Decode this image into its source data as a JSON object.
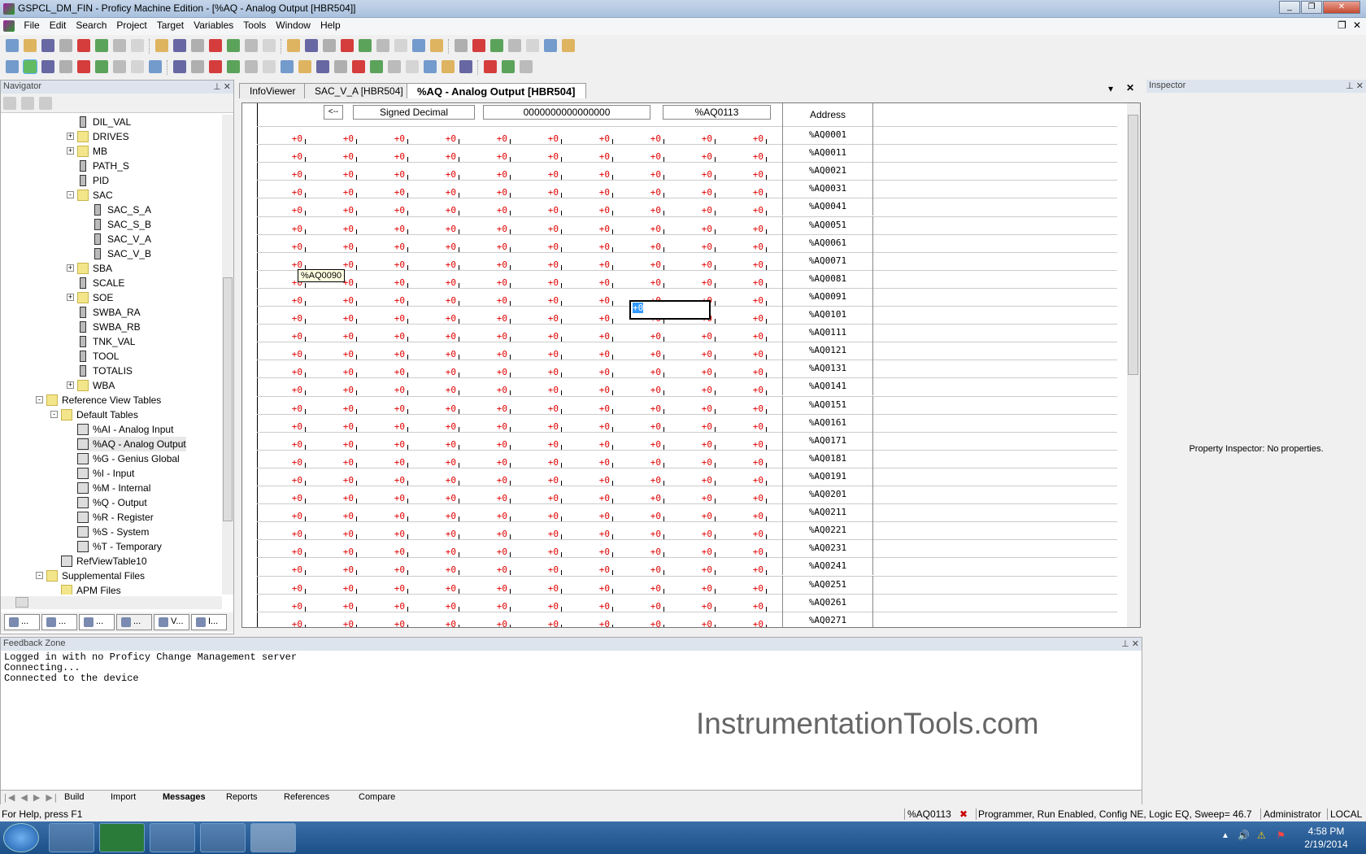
{
  "title": "GSPCL_DM_FIN - Proficy Machine Edition - [%AQ - Analog Output [HBR504]]",
  "menu": [
    "File",
    "Edit",
    "Search",
    "Project",
    "Target",
    "Variables",
    "Tools",
    "Window",
    "Help"
  ],
  "toolbar1": [
    "new-project-icon",
    "open-icon",
    "save-icon",
    "print-icon",
    "validate-check-icon",
    "download-icon",
    "upload-icon",
    "bulb-icon",
    "|",
    "cut-icon",
    "copy-icon",
    "paste-icon",
    "undo-icon",
    "redo-icon",
    "delete-icon",
    "find-icon",
    "|",
    "navigator-icon",
    "variables-icon",
    "toolchest-icon",
    "inspector-icon",
    "watch-icon",
    "companion-icon",
    "network-icon",
    "favorites-icon",
    "help-icon",
    "|",
    "back-icon",
    "forward-icon",
    "stop-icon",
    "refresh-icon",
    "home-icon",
    "infoviewer-icon",
    "export-icon"
  ],
  "toolbar2": [
    "online-icon",
    "programmer-mode-icon",
    "rewind-icon",
    "run-icon",
    "step-icon",
    "stop-icon",
    "pause-icon",
    "restart-icon",
    "alert-icon",
    "|",
    "select-icon",
    "contact-no-icon",
    "contact-nc-icon",
    "coil-icon",
    "coil-neg-icon",
    "coil-pos-icon",
    "coil-neg-trans-icon",
    "set-coil-icon",
    "reset-coil-icon",
    "timer-icon",
    "counter-icon",
    "function-block-icon",
    "function-block2-icon",
    "wire-icon",
    "branch-icon",
    "comment-icon",
    "edit-icon",
    "|",
    "binoculars-icon",
    "search-replace-icon",
    "find-all-icon"
  ],
  "navigator": {
    "title": "Navigator",
    "items": [
      {
        "label": "DIL_VAL",
        "type": "block",
        "level": 3
      },
      {
        "label": "DRIVES",
        "type": "folder",
        "level": 3,
        "exp": "+"
      },
      {
        "label": "MB",
        "type": "folder",
        "level": 3,
        "exp": "+"
      },
      {
        "label": "PATH_S",
        "type": "block",
        "level": 3
      },
      {
        "label": "PID",
        "type": "block",
        "level": 3
      },
      {
        "label": "SAC",
        "type": "folder",
        "level": 3,
        "exp": "-"
      },
      {
        "label": "SAC_S_A",
        "type": "block",
        "level": 4
      },
      {
        "label": "SAC_S_B",
        "type": "block",
        "level": 4
      },
      {
        "label": "SAC_V_A",
        "type": "block",
        "level": 4
      },
      {
        "label": "SAC_V_B",
        "type": "block",
        "level": 4
      },
      {
        "label": "SBA",
        "type": "folder",
        "level": 3,
        "exp": "+"
      },
      {
        "label": "SCALE",
        "type": "block",
        "level": 3
      },
      {
        "label": "SOE",
        "type": "folder",
        "level": 3,
        "exp": "+"
      },
      {
        "label": "SWBA_RA",
        "type": "block",
        "level": 3
      },
      {
        "label": "SWBA_RB",
        "type": "block",
        "level": 3
      },
      {
        "label": "TNK_VAL",
        "type": "block",
        "level": 3
      },
      {
        "label": "TOOL",
        "type": "block",
        "level": 3
      },
      {
        "label": "TOTALIS",
        "type": "block",
        "level": 3
      },
      {
        "label": "WBA",
        "type": "folder",
        "level": 3,
        "exp": "+"
      },
      {
        "label": "Reference View Tables",
        "type": "folder",
        "level": 1,
        "exp": "-"
      },
      {
        "label": "Default Tables",
        "type": "folder",
        "level": 2,
        "exp": "-"
      },
      {
        "label": "%AI - Analog Input",
        "type": "tbl",
        "level": 3
      },
      {
        "label": "%AQ - Analog Output",
        "type": "tbl",
        "level": 3,
        "selected": true
      },
      {
        "label": "%G - Genius Global",
        "type": "tbl",
        "level": 3
      },
      {
        "label": "%I - Input",
        "type": "tbl",
        "level": 3
      },
      {
        "label": "%M - Internal",
        "type": "tbl",
        "level": 3
      },
      {
        "label": "%Q - Output",
        "type": "tbl",
        "level": 3
      },
      {
        "label": "%R - Register",
        "type": "tbl",
        "level": 3
      },
      {
        "label": "%S - System",
        "type": "tbl",
        "level": 3
      },
      {
        "label": "%T - Temporary",
        "type": "tbl",
        "level": 3
      },
      {
        "label": "RefViewTable10",
        "type": "tbl",
        "level": 2
      },
      {
        "label": "Supplemental Files",
        "type": "folder",
        "level": 1,
        "exp": "-"
      },
      {
        "label": "APM Files",
        "type": "folder",
        "level": 2
      }
    ],
    "tabs": [
      "...",
      "...",
      "...",
      "...",
      "V...",
      "I..."
    ]
  },
  "tabs": [
    "InfoViewer",
    "SAC_V_A [HBR504]",
    "%AQ - Analog Output [HBR504]"
  ],
  "grid": {
    "back_button": "<--",
    "format": "Signed Decimal",
    "binary": "0000000000000000",
    "current_address": "%AQ0113",
    "address_header": "Address",
    "cell_value": "+0",
    "tooltip": "%AQ0090",
    "editing_value": "+0",
    "addresses": [
      "%AQ0001",
      "%AQ0011",
      "%AQ0021",
      "%AQ0031",
      "%AQ0041",
      "%AQ0051",
      "%AQ0061",
      "%AQ0071",
      "%AQ0081",
      "%AQ0091",
      "%AQ0101",
      "%AQ0111",
      "%AQ0121",
      "%AQ0131",
      "%AQ0141",
      "%AQ0151",
      "%AQ0161",
      "%AQ0171",
      "%AQ0181",
      "%AQ0191",
      "%AQ0201",
      "%AQ0211",
      "%AQ0221",
      "%AQ0231",
      "%AQ0241",
      "%AQ0251",
      "%AQ0261",
      "%AQ0271"
    ]
  },
  "inspector": {
    "title": "Inspector",
    "message": "Property Inspector: No properties."
  },
  "feedback": {
    "title": "Feedback Zone",
    "log": "Logged in with no Proficy Change Management server\nConnecting...\nConnected to the device",
    "tabs": [
      "Build",
      "Import",
      "Messages",
      "Reports",
      "References",
      "Compare"
    ],
    "active_tab": "Messages"
  },
  "watermark": "InstrumentationTools.com",
  "status": {
    "help": "For Help, press F1",
    "address": "%AQ0113",
    "target_status": "Programmer, Run Enabled, Config NE, Logic EQ, Sweep= 46.7",
    "user": "Administrator",
    "mode": "LOCAL"
  },
  "taskbar": {
    "time": "4:58 PM",
    "date": "2/19/2014"
  }
}
